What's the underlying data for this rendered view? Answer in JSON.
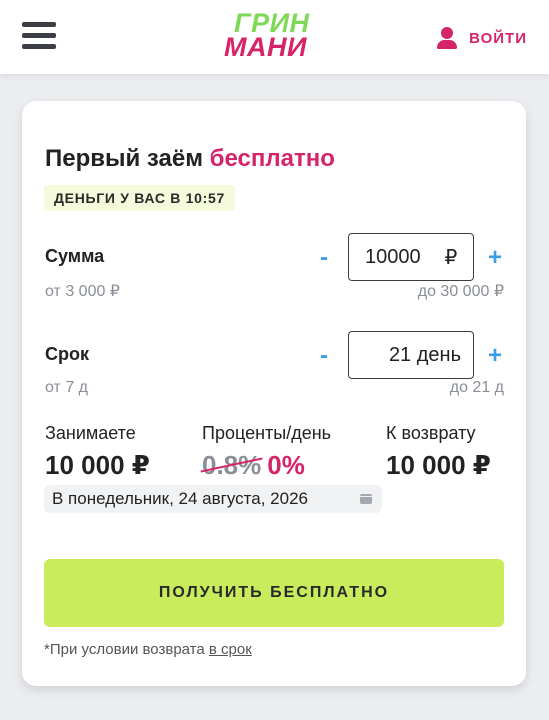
{
  "header": {
    "logo_line1": "ГРИН",
    "logo_line2": "МАНИ",
    "login_label": "ВОЙТИ"
  },
  "card": {
    "title_main": "Первый заём",
    "title_accent": "бесплатно",
    "badge": "ДЕНЬГИ У ВАС В 10:57",
    "amount": {
      "label": "Сумма",
      "value": "10000",
      "currency": "₽",
      "min": "от 3 000 ₽",
      "max": "до 30 000 ₽",
      "minus": "-",
      "plus": "+"
    },
    "term": {
      "label": "Срок",
      "value": "21 день",
      "min": "от 7 д",
      "max": "до 21 д",
      "minus": "-",
      "plus": "+"
    },
    "summary": {
      "borrow_label": "Занимаете",
      "borrow_value": "10 000 ₽",
      "rate_label": "Проценты/день",
      "rate_old": "0.8%",
      "rate_new": "0%",
      "return_label": "К возврату",
      "return_value": "10 000 ₽"
    },
    "due_date": "В понедельник, 24 августа, 2026",
    "cta_label": "ПОЛУЧИТЬ БЕСПЛАТНО",
    "footnote_text": "*При условии возврата",
    "footnote_link": "в срок"
  },
  "colors": {
    "accent_pink": "#d6246b",
    "accent_green": "#7ed957",
    "cta_green": "#c8ec5c",
    "stepper_blue": "#3a9ee4"
  },
  "icons": [
    "menu-icon",
    "user-icon",
    "calendar-icon"
  ]
}
